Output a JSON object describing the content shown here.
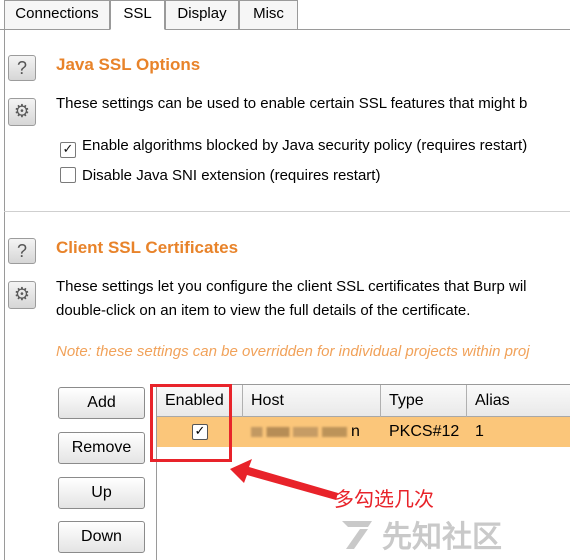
{
  "tabs": [
    {
      "label": "Connections",
      "active": false
    },
    {
      "label": "SSL",
      "active": true
    },
    {
      "label": "Display",
      "active": false
    },
    {
      "label": "Misc",
      "active": false
    }
  ],
  "java_ssl": {
    "title": "Java SSL Options",
    "description": "These settings can be used to enable certain SSL features that might b",
    "options": [
      {
        "label": "Enable algorithms blocked by Java security policy (requires restart)",
        "checked": true
      },
      {
        "label": "Disable Java SNI extension (requires restart)",
        "checked": false
      }
    ]
  },
  "client_ssl": {
    "title": "Client SSL Certificates",
    "description_line1": "These settings let you configure the client SSL certificates that Burp wil",
    "description_line2": "double-click on an item to view the full details of the certificate.",
    "note": "Note: these settings can be overridden for individual projects within proj",
    "buttons": {
      "add": "Add",
      "remove": "Remove",
      "up": "Up",
      "down": "Down"
    },
    "table": {
      "columns": [
        "Enabled",
        "Host",
        "Type",
        "Alias"
      ],
      "rows": [
        {
          "enabled": true,
          "host_suffix": "n",
          "type": "PKCS#12",
          "alias": "1"
        }
      ]
    }
  },
  "icons": {
    "help": "?",
    "gear": "⚙",
    "check": "✓"
  },
  "annotation": {
    "text": "多勾选几次",
    "color": "#e8232a"
  },
  "watermark": {
    "text": "先知社区"
  },
  "colors": {
    "accent": "#e8832a",
    "row_highlight": "#fbc67a",
    "note": "#f1a25a"
  }
}
